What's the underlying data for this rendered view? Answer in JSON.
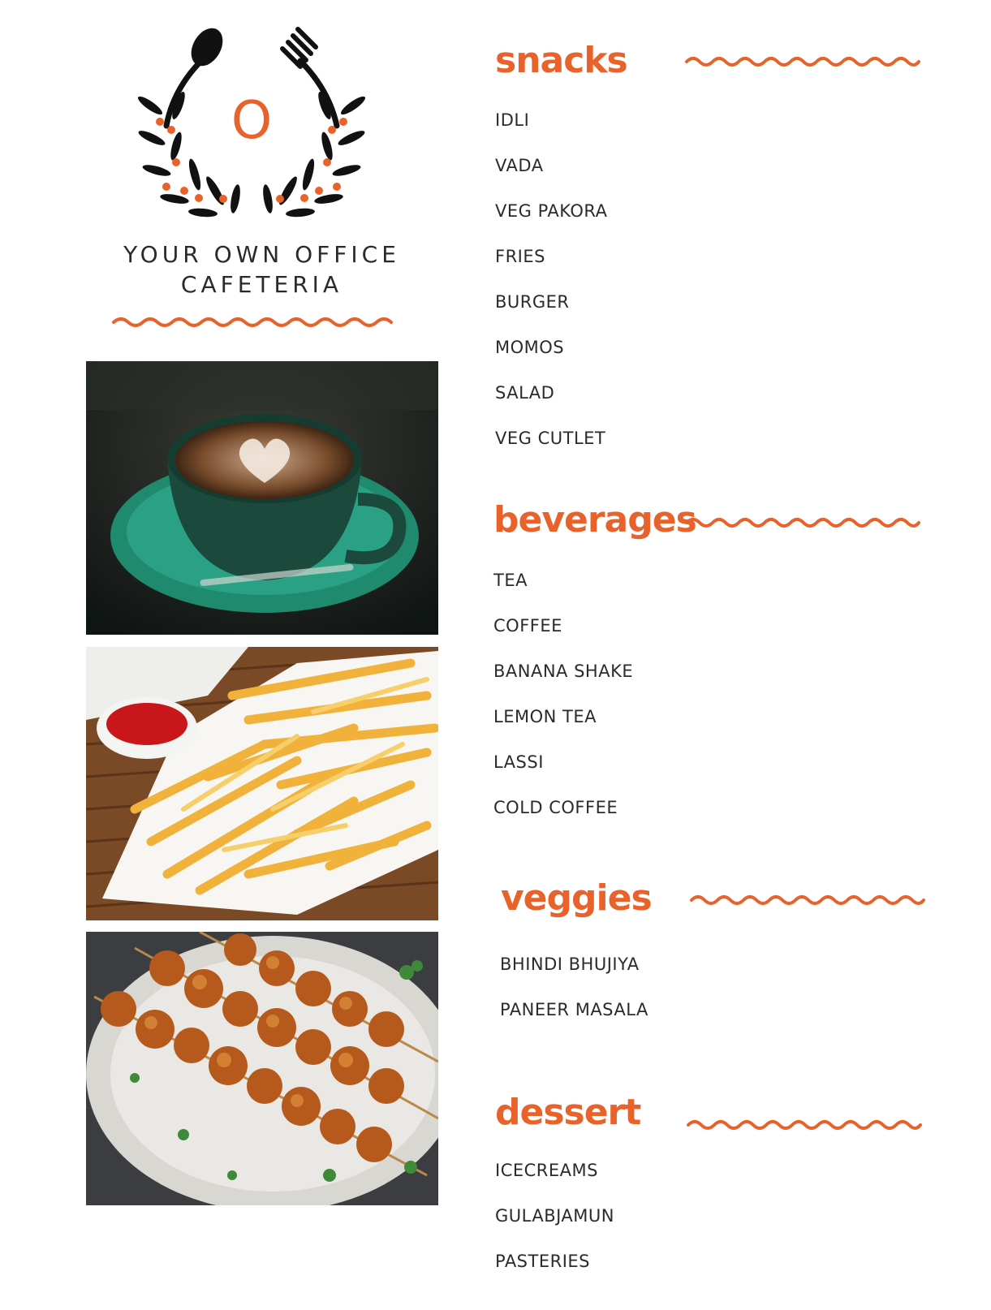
{
  "brand": {
    "line1": "YOUR OWN OFFICE",
    "line2": "CAFETERIA",
    "logo_icon": "cafeteria-wreath-logo",
    "logo_letter": "O"
  },
  "colors": {
    "accent": "#e8632b",
    "text": "#2b2b2b"
  },
  "photos": [
    {
      "name": "coffee-photo",
      "subject": "latte cup with heart art"
    },
    {
      "name": "fries-photo",
      "subject": "french fries with ketchup"
    },
    {
      "name": "kebab-photo",
      "subject": "veg seekh kebab skewers"
    }
  ],
  "menu": {
    "snacks": {
      "title": "snacks",
      "items": [
        "IDLI",
        "VADA",
        "VEG PAKORA",
        "FRIES",
        "BURGER",
        "MOMOS",
        "SALAD",
        "VEG CUTLET"
      ]
    },
    "beverages": {
      "title": "beverages",
      "items": [
        "TEA",
        "COFFEE",
        "BANANA SHAKE",
        "LEMON TEA",
        "LASSI",
        "COLD COFFEE"
      ]
    },
    "veggies": {
      "title": "veggies",
      "items": [
        "BHINDI BHUJIYA",
        "PANEER MASALA"
      ]
    },
    "dessert": {
      "title": "dessert",
      "items": [
        "ICECREAMS",
        "GULABJAMUN",
        "PASTERIES"
      ]
    }
  }
}
